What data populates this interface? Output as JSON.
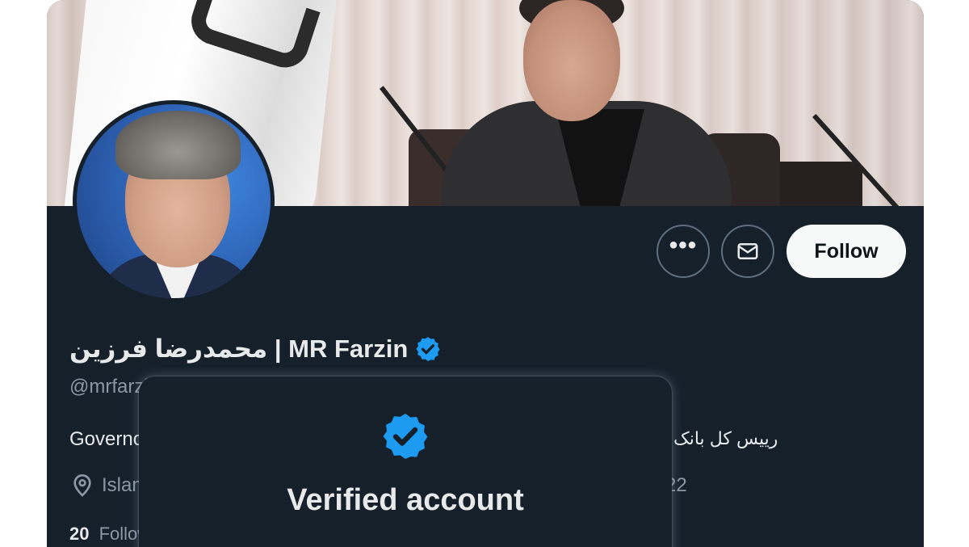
{
  "profile": {
    "display_name": "محمدرضا فرزین | MR Farzin",
    "handle": "@mrfarzin",
    "bio_left": "Governor",
    "bio_right": "رییس کل بانک",
    "location": "Islamic Republic of Iran",
    "joined_tail": "22",
    "following_count": "20",
    "following_label": "Following"
  },
  "actions": {
    "more_label": "•••",
    "follow_label": "Follow"
  },
  "popover": {
    "title": "Verified account"
  },
  "icons": {
    "verified": "verified-badge-icon",
    "message": "envelope-icon",
    "location": "map-pin-icon"
  },
  "colors": {
    "background": "#15202b",
    "verified_blue": "#1d9bf0",
    "text_primary": "#e7e9ea",
    "text_secondary": "#8b98a5"
  }
}
